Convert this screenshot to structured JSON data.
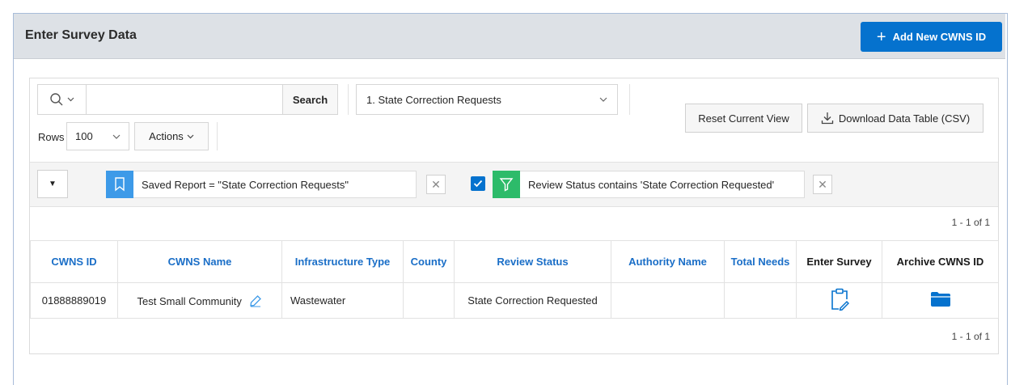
{
  "region": {
    "title": "Enter Survey Data",
    "add_button_label": "Add New CWNS ID",
    "accent_color": "#0572ce"
  },
  "toolbar": {
    "search_placeholder": "",
    "search_button_label": "Search",
    "report_selected": "1. State Correction Requests",
    "rows_label": "Rows",
    "rows_value": "100",
    "actions_label": "Actions",
    "reset_label": "Reset Current View",
    "download_label": "Download Data Table (CSV)"
  },
  "filters": {
    "saved_report": "Saved Report = \"State Correction Requests\"",
    "review_filter": "Review Status contains 'State Correction Requested'"
  },
  "pagination": {
    "top": "1 - 1 of 1",
    "bottom": "1 - 1 of 1"
  },
  "table": {
    "columns": [
      "CWNS ID",
      "CWNS Name",
      "Infrastructure Type",
      "County",
      "Review Status",
      "Authority Name",
      "Total Needs",
      "Enter Survey",
      "Archive CWNS ID"
    ],
    "rows": [
      {
        "cwns_id": "01888889019",
        "cwns_name": "Test Small Community",
        "infrastructure_type": "Wastewater",
        "county": "",
        "review_status": "State Correction Requested",
        "authority_name": "",
        "total_needs": ""
      }
    ]
  },
  "icons": {
    "search": "search-icon",
    "bookmark": "bookmark-icon",
    "filter": "filter-icon",
    "clipboard_edit": "clipboard-edit-icon",
    "folder": "folder-icon",
    "download": "download-icon",
    "edit": "pencil-icon"
  }
}
